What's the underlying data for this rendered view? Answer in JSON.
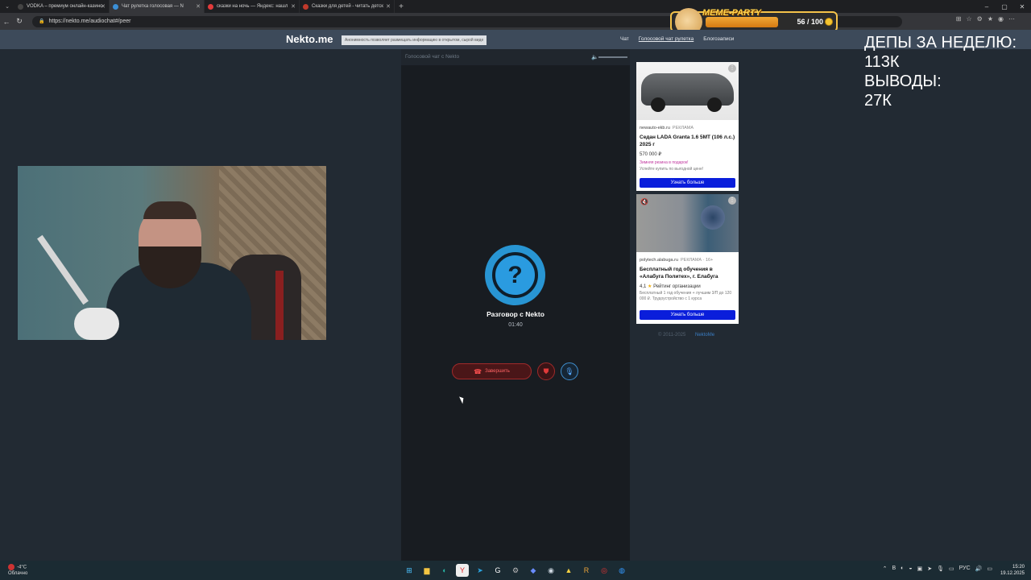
{
  "browser": {
    "tabs": [
      {
        "label": "VODKA – премиум онлайн-казино",
        "color": "#1a1a1a",
        "active": false
      },
      {
        "label": "Чат рулетка голосовая — N",
        "color": "#3b8fd6",
        "active": true
      },
      {
        "label": "сказки на ночь — Яндекс: нашл",
        "color": "#e23b3b",
        "active": false
      },
      {
        "label": "Сказки для детей - читать детск",
        "color": "#c0392b",
        "active": false
      }
    ],
    "url": "https://nekto.me/audiochat#/peer"
  },
  "meme_party": {
    "title": "MEME-PARTY",
    "count": "56 / 100"
  },
  "site": {
    "logo": "Nekto.me",
    "anon_notice": "Анонимность позволяет размещать информацию в открытом, сырой виде",
    "menu": [
      "Чат",
      "Голосовой чат рулетка",
      "Блогозаписи"
    ]
  },
  "chat": {
    "header_title": "Голосовой чат с Nekto",
    "avatar_symbol": "?",
    "talk_title": "Разговор с Nekto",
    "timer": "01:40",
    "end_label": "Завершить"
  },
  "ads": [
    {
      "source": "newauto-ekb.ru",
      "badge": "РЕКЛАМА",
      "headline": "Седан LADA Granta 1.6 5MT (106 л.с.) 2025 г",
      "price": "570 000 ₽",
      "promo": "Зимняя резина в подарок!",
      "sub": "Успейте купить по выгодной цене!",
      "cta": "Узнать больше"
    },
    {
      "source": "polytech.alabuga.ru",
      "badge": "РЕКЛАМА · 16+",
      "headline": "Бесплатный год обучения в «Алабуга Политех», г. Елабуга",
      "rating_value": "4,1",
      "rating_label": "Рейтинг организации",
      "sub": "Бесплатный 1 год обучения + лучшим 3/П до 120 000 ₽. Трудоустройство с 1 курса",
      "cta": "Узнать больше"
    }
  ],
  "footer": {
    "copyright": "© 2011-2025",
    "link": "NektoMe"
  },
  "stream_overlay": {
    "line1": "ДЕПЫ ЗА НЕДЕЛЮ:",
    "line2": "113К",
    "line3": "ВЫВОДЫ:",
    "line4": "27К"
  },
  "taskbar": {
    "temp": "-4°C",
    "weather": "Облачно",
    "lang": "РУС",
    "time": "15:20",
    "date": "19.12.2025"
  }
}
